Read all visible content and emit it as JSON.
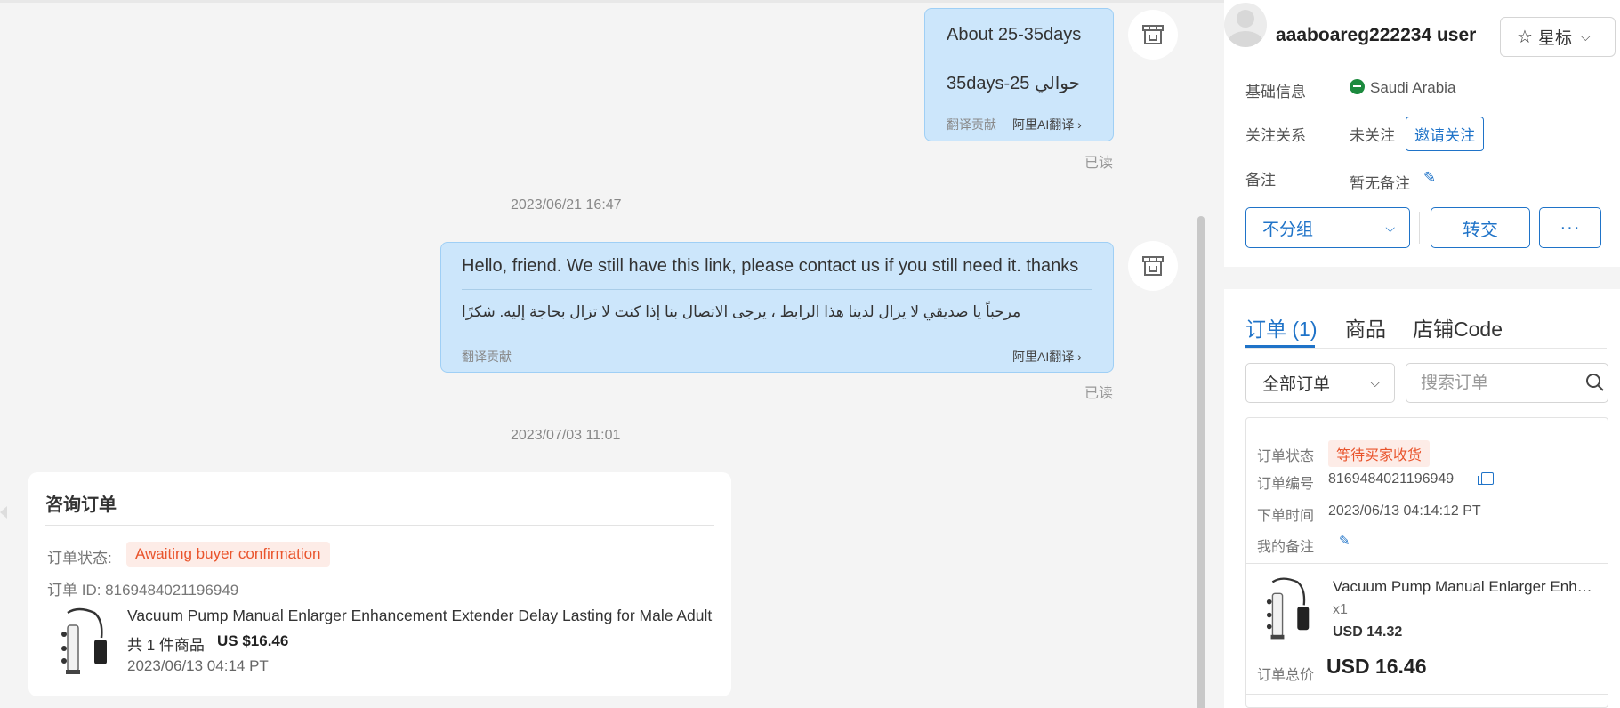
{
  "chat": {
    "messages": [
      {
        "text": "About 25-35days",
        "translation": "حوالي 25-35days",
        "contrib": "翻译贡献",
        "ai": "阿里AI翻译",
        "read": "已读"
      },
      {
        "timestamp": "2023/06/21 16:47",
        "text": "Hello, friend. We still have this link, please contact us if you still need it. thanks",
        "translation": "مرحباً يا صديقي لا يزال لدينا هذا الرابط ، يرجى الاتصال بنا إذا كنت لا تزال بحاجة إليه. شكرًا",
        "contrib": "翻译贡献",
        "ai": "阿里AI翻译",
        "read": "已读"
      }
    ],
    "order_timestamp": "2023/07/03 11:01",
    "order_card": {
      "title": "咨询订单",
      "status_label": "订单状态:",
      "status": "Awaiting buyer confirmation",
      "order_id": "订单 ID: 8169484021196949",
      "product_title": "Vacuum Pump Manual Enlarger Enhancement Extender Delay Lasting for Male Adult",
      "count": "共 1 件商品",
      "price": "US $16.46",
      "date": "2023/06/13 04:14 PT"
    }
  },
  "profile": {
    "username": "aaaboareg222234 user",
    "star_label": "星标",
    "basic_info_label": "基础信息",
    "country": "Saudi Arabia",
    "follow_label": "关注关系",
    "follow_value": "未关注",
    "invite_label": "邀请关注",
    "note_label": "备注",
    "note_value": "暂无备注",
    "group_label": "不分组",
    "transfer_label": "转交",
    "more_label": "···"
  },
  "orders": {
    "tabs": [
      "订单 (1)",
      "商品",
      "店铺Code"
    ],
    "filter": "全部订单",
    "search_placeholder": "搜索订单",
    "status_label": "订单状态",
    "status": "等待买家收货",
    "number_label": "订单编号",
    "number": "8169484021196949",
    "time_label": "下单时间",
    "time": "2023/06/13 04:14:12 PT",
    "note_label": "我的备注",
    "product_title": "Vacuum Pump Manual Enlarger Enhancement Extender Delay Lasting for Male Adult",
    "qty": "x1",
    "unit_price": "USD 14.32",
    "total_label": "订单总价",
    "total": "USD 16.46"
  },
  "colors": {
    "accent": "#1f73c8",
    "bubble": "#cce6fb",
    "status": "#e9542c"
  }
}
